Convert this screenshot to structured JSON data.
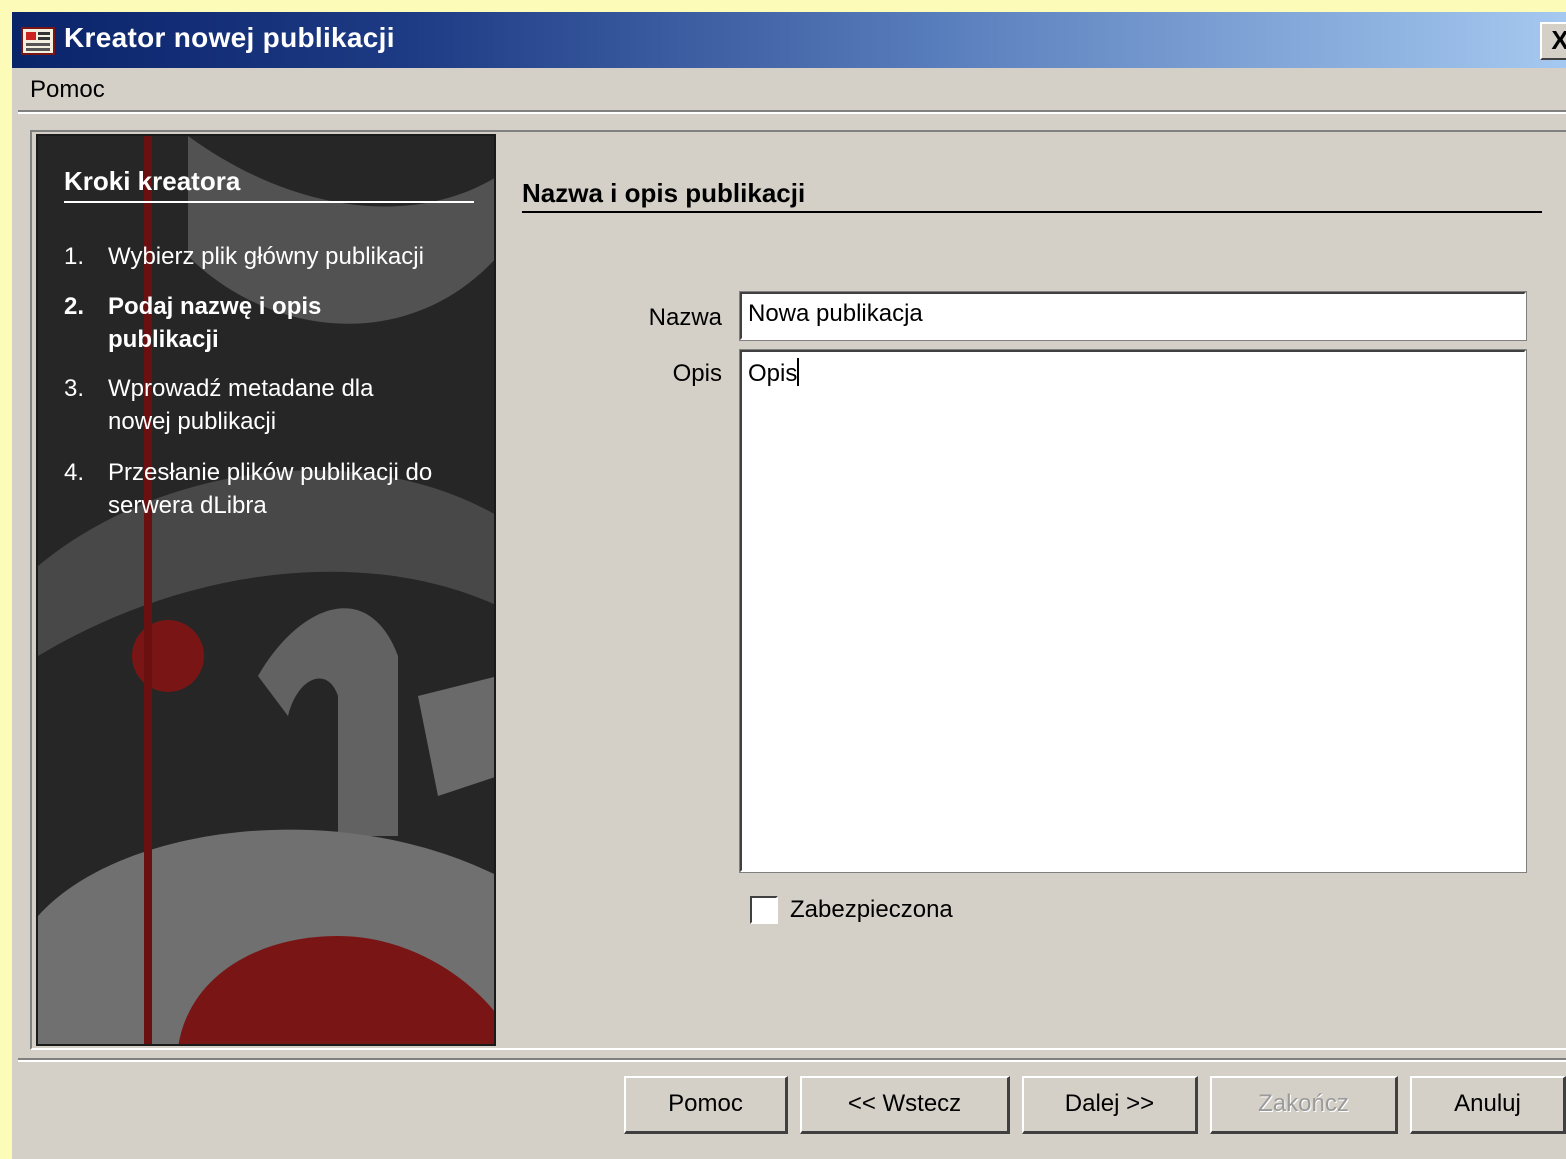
{
  "window": {
    "title": "Kreator nowej publikacji",
    "close_label": "X"
  },
  "menu": {
    "items": [
      "Pomoc"
    ]
  },
  "sidebar": {
    "title": "Kroki kreatora",
    "steps": [
      {
        "num": "1.",
        "label": "Wybierz plik główny publikacji",
        "active": false
      },
      {
        "num": "2.",
        "label": "Podaj nazwę i opis publikacji",
        "active": true
      },
      {
        "num": "3.",
        "label": "Wprowadź metadane dla nowej publikacji",
        "active": false
      },
      {
        "num": "4.",
        "label": "Przesłanie plików publikacji do serwera dLibra",
        "active": false
      }
    ]
  },
  "form": {
    "section_title": "Nazwa i opis publikacji",
    "name_label": "Nazwa",
    "name_value": "Nowa publikacja",
    "desc_label": "Opis",
    "desc_value": "Opis",
    "checkbox_label": "Zabezpieczona",
    "checkbox_checked": false
  },
  "buttons": {
    "help": "Pomoc",
    "back": "<< Wstecz",
    "next": "Dalej >>",
    "finish": "Zakończ",
    "cancel": "Anuluj"
  },
  "colors": {
    "titlebar_start": "#0a246a",
    "titlebar_end": "#a6caf0",
    "sidebar_bg": "#2a2a2a",
    "accent_red": "#7a1515"
  }
}
